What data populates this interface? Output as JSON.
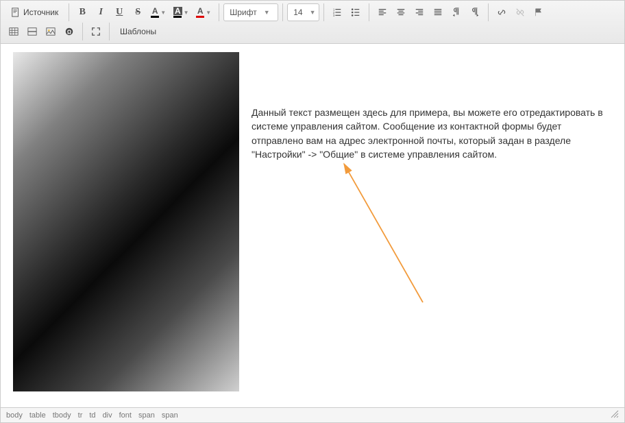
{
  "toolbar": {
    "source": "Источник",
    "font_label": "Шрифт",
    "size_label": "14",
    "templates": "Шаблоны"
  },
  "content": {
    "text": "Данный текст размещен здесь для примера, вы можете его отредактировать в системе управления сайтом. Сообщение из контактной формы будет отправлено вам на адрес электронной почты, который задан в разделе \"Настройки\" -> \"Общие\" в системе управления сайтом."
  },
  "breadcrumbs": [
    "body",
    "table",
    "tbody",
    "tr",
    "td",
    "div",
    "font",
    "span",
    "span"
  ],
  "annotation": {
    "arrow_color": "#f29b3c"
  }
}
